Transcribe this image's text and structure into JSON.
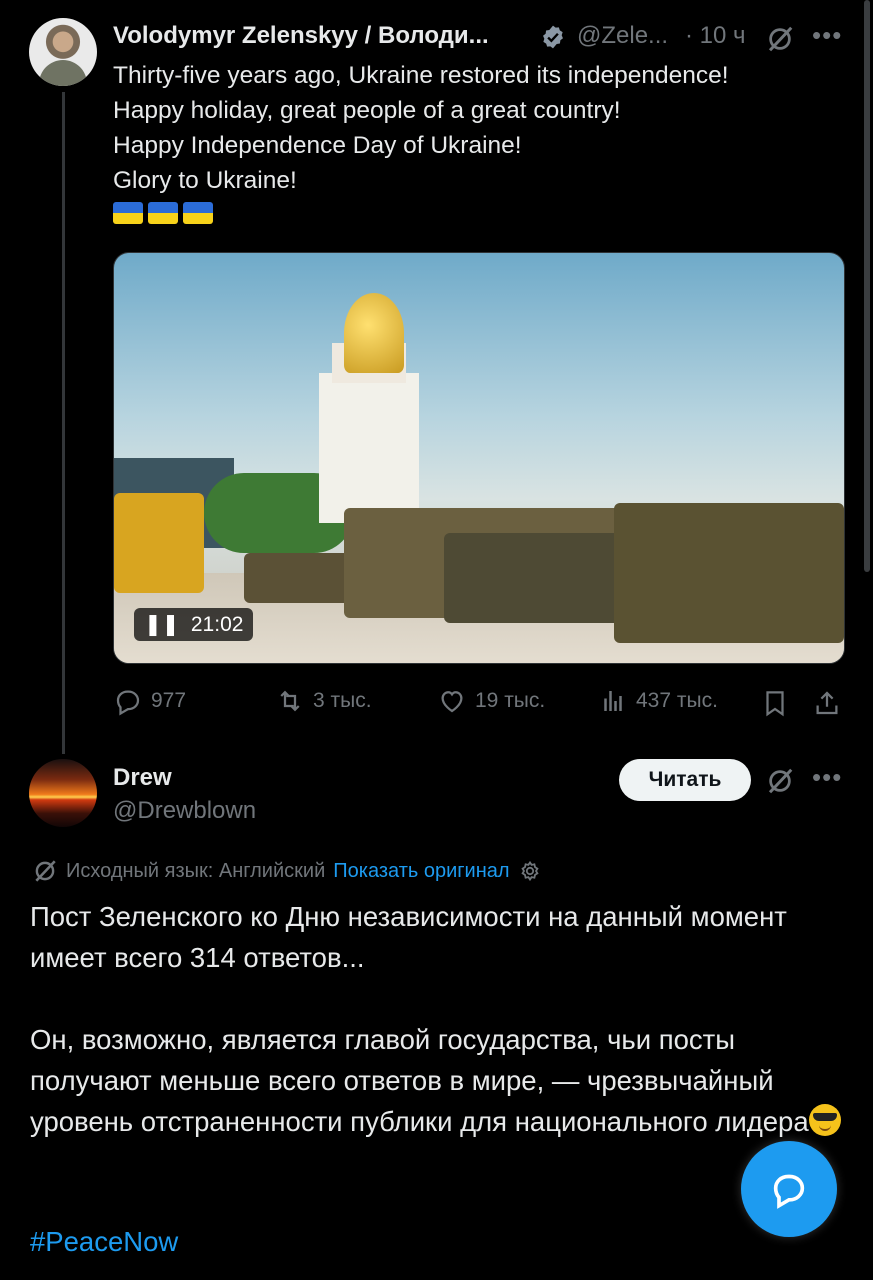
{
  "post": {
    "author_name": "Volodymyr Zelenskyy / Володи...",
    "handle": "@Zele...",
    "time": "· 10 ч",
    "lines": [
      "Thirty-five years ago, Ukraine restored its independence!",
      "Happy holiday, great people of a great country!",
      "Happy Independence Day of Ukraine!",
      "Glory to Ukraine!"
    ],
    "flags_emoji": "🇺🇦🇺🇦🇺🇦",
    "video_time": "21:02",
    "actions": {
      "replies": "977",
      "reposts": "3 тыс.",
      "likes": "19 тыс.",
      "views": "437 тыс."
    }
  },
  "reply": {
    "author_name": "Drew",
    "handle": "@Drewblown",
    "read_button": "Читать",
    "translate_label": "Исходный язык: Английский",
    "show_original": "Показать оригинал",
    "paragraph1": "Пост Зеленского ко Дню независимости на данный момент имеет всего 314 ответов...",
    "paragraph2": "Он, возможно, является главой государства, чьи посты получают меньше всего ответов в мире, — чрезвычайный уровень отстраненности публики для национального лидера",
    "emoji": "😎",
    "hashtag": "#PeaceNow"
  },
  "colors": {
    "background": "#000000",
    "text": "#e7e9ea",
    "muted": "#71767b",
    "accent": "#1d9bf0"
  }
}
